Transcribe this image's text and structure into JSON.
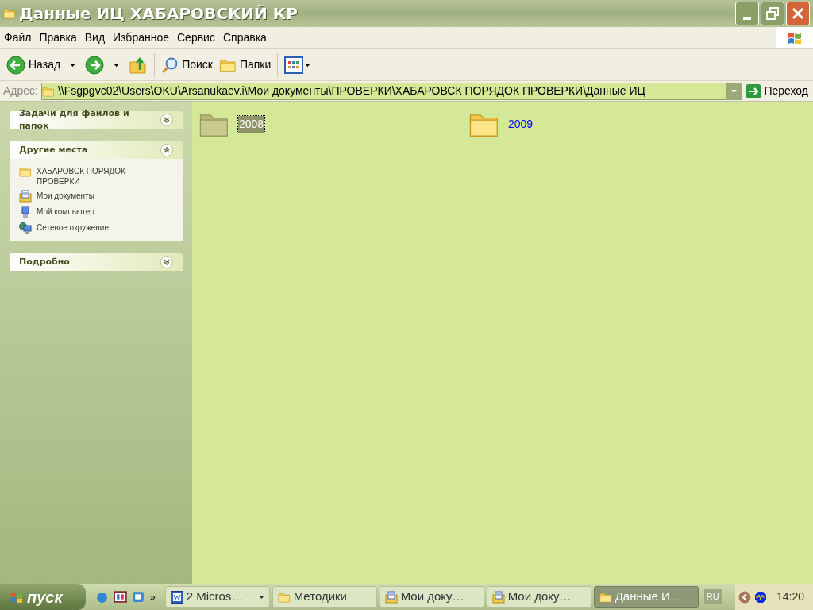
{
  "window": {
    "title": "Данные ИЦ ХАБАРОВСКИЙ КР"
  },
  "menu": [
    "Файл",
    "Правка",
    "Вид",
    "Избранное",
    "Сервис",
    "Справка"
  ],
  "toolbar": {
    "back": "Назад",
    "search": "Поиск",
    "folders": "Папки"
  },
  "address": {
    "label": "Адрес:",
    "value": "\\\\Fsgpgvc02\\Users\\OKU\\Arsanukaev.i\\Мои документы\\ПРОВЕРКИ\\ХАБАРОВСК ПОРЯДОК ПРОВЕРКИ\\Данные ИЦ",
    "go": "Переход"
  },
  "sidebar": [
    {
      "title": "Задачи для файлов и папок",
      "expanded": false
    },
    {
      "title": "Другие места",
      "expanded": true,
      "items": [
        {
          "kind": "folder",
          "label": "ХАБАРОВСК ПОРЯДОК ПРОВЕРКИ"
        },
        {
          "kind": "documents",
          "label": "Мои документы"
        },
        {
          "kind": "computer",
          "label": "Мой компьютер"
        },
        {
          "kind": "network",
          "label": "Сетевое окружение"
        }
      ]
    },
    {
      "title": "Подробно",
      "expanded": false
    }
  ],
  "files": [
    {
      "name": "2008",
      "selected": true
    },
    {
      "name": "2009",
      "selected": false
    }
  ],
  "taskbar": {
    "start": "пуск",
    "chevron": "»",
    "tasks": [
      {
        "kind": "word",
        "label": "2 Micros…",
        "active": false,
        "group": true
      },
      {
        "kind": "folder",
        "label": "Методики",
        "active": false,
        "group": false
      },
      {
        "kind": "documents",
        "label": "Мои доку…",
        "active": false,
        "group": false
      },
      {
        "kind": "documents",
        "label": "Мои доку…",
        "active": false,
        "group": false
      },
      {
        "kind": "folder",
        "label": "Данные И…",
        "active": true,
        "group": false
      }
    ],
    "language": "RU",
    "clock": "14:20"
  }
}
